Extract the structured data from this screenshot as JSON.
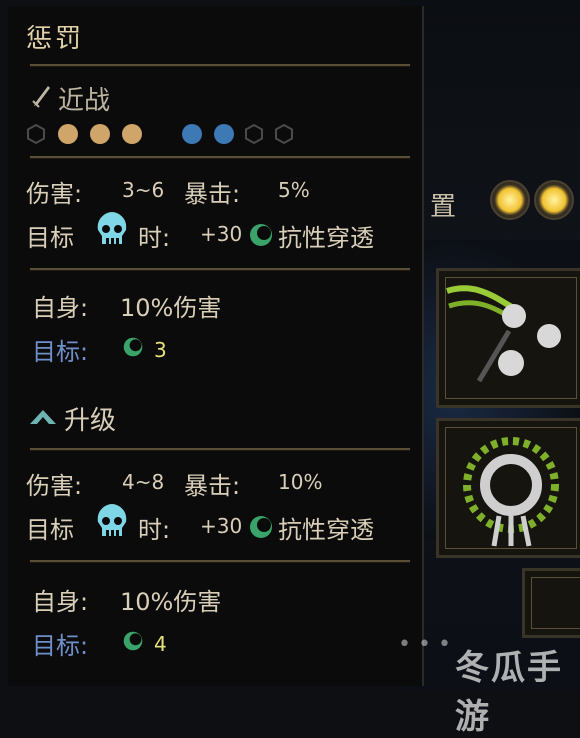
{
  "scene": {
    "label": "置",
    "pips": 2
  },
  "tooltip": {
    "title": "惩罚",
    "type_label": "近战",
    "positions": {
      "caster": [
        "empty",
        "gold",
        "gold",
        "gold"
      ],
      "target": [
        "blue",
        "blue",
        "empty",
        "empty"
      ]
    },
    "base": {
      "damage_label": "伤害:",
      "damage_value": "3~6",
      "crit_label": "暴击:",
      "crit_value": "5%",
      "target_prefix": "目标",
      "target_suffix": "时:",
      "bonus_value": "+30",
      "bonus_text": "抗性穿透",
      "self_label": "自身:",
      "self_value": "10%伤害",
      "target_label": "目标:",
      "target_value": "3"
    },
    "upgrade_label": "升级",
    "upgraded": {
      "damage_label": "伤害:",
      "damage_value": "4~8",
      "crit_label": "暴击:",
      "crit_value": "10%",
      "target_prefix": "目标",
      "target_suffix": "时:",
      "bonus_value": "+30",
      "bonus_text": "抗性穿透",
      "self_label": "自身:",
      "self_value": "10%伤害",
      "target_label": "目标:",
      "target_value": "4"
    }
  },
  "watermark": "冬瓜手游",
  "colors": {
    "accent_gold": "#d0a56a",
    "accent_blue": "#3d79b5",
    "skull_cyan": "#7fd6e6",
    "swirl_green": "#3aa36a"
  }
}
